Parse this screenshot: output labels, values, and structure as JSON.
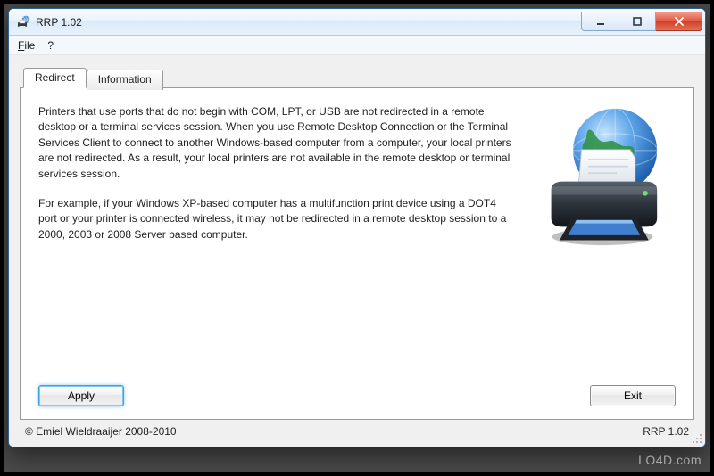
{
  "window": {
    "title": "RRP 1.02",
    "icon": "printer-globe-icon"
  },
  "menu": {
    "file": "File",
    "help": "?"
  },
  "tabs": {
    "redirect": "Redirect",
    "information": "Information",
    "active": "redirect"
  },
  "content": {
    "paragraph1": "Printers that use ports that do not begin with COM, LPT, or USB are not redirected  in a remote desktop or a terminal services session. When you use Remote Desktop Connection or the Terminal Services Client to connect to another Windows-based computer from a computer, your local printers are not redirected. As a result, your local printers are not available in the remote desktop or terminal services session.",
    "paragraph2": "For example, if your Windows XP-based computer has a multifunction print device using a DOT4 port or your printer is connected wireless, it may not be redirected in a remote desktop session to a 2000, 2003 or 2008 Server based computer."
  },
  "buttons": {
    "apply": "Apply",
    "exit": "Exit"
  },
  "status": {
    "copyright": "© Emiel Wieldraaijer 2008-2010",
    "version": "RRP 1.02"
  },
  "watermark": "LO4D.com",
  "illustration": "printer-with-globe"
}
